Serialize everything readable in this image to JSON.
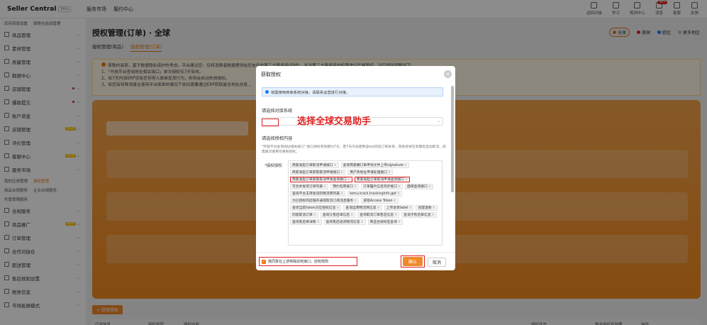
{
  "brand": {
    "name": "Seller Central",
    "badge": "Beta"
  },
  "topnav": [
    "服务市场",
    "履约中心"
  ],
  "topright": [
    {
      "label": "返回对接",
      "badge": ""
    },
    {
      "label": "学习",
      "badge": ""
    },
    {
      "label": "规则中心",
      "badge": ""
    },
    {
      "label": "消息",
      "badge": "99+"
    },
    {
      "label": "客服",
      "badge": ""
    },
    {
      "label": "反馈",
      "badge": ""
    }
  ],
  "sidebar": {
    "top_sub": [
      "库存回退设置",
      "保税仓追加管理"
    ],
    "items": [
      {
        "label": "商品管理",
        "flag": ""
      },
      {
        "label": "素材管理",
        "flag": ""
      },
      {
        "label": "质量管理",
        "flag": ""
      },
      {
        "label": "数据中心",
        "flag": ""
      },
      {
        "label": "店铺管理",
        "flag": "dot"
      },
      {
        "label": "爆款提交",
        "flag": "dot"
      },
      {
        "label": "账户资金",
        "flag": ""
      },
      {
        "label": "店铺管理",
        "flag": "NEW"
      },
      {
        "label": "评价管理",
        "flag": ""
      },
      {
        "label": "客服中心",
        "flag": "NEW"
      },
      {
        "label": "服务市场",
        "flag": ""
      }
    ],
    "sub1": [
      "我的应用管理",
      "授权管理"
    ],
    "sub2": [
      "商品合规服务",
      "企业合规服务"
    ],
    "sub3": [
      "托管保障服务"
    ],
    "items2": [
      {
        "label": "合规服务",
        "flag": ""
      },
      {
        "label": "商品推广",
        "flag": "NEW"
      },
      {
        "label": "订单管理",
        "flag": ""
      },
      {
        "label": "合作对接仓",
        "flag": ""
      },
      {
        "label": "配送管理",
        "flag": ""
      },
      {
        "label": "售后规则设置",
        "flag": ""
      },
      {
        "label": "税务信息",
        "flag": ""
      },
      {
        "label": "市场拓展模式",
        "flag": ""
      }
    ]
  },
  "page": {
    "title": "授权管理(订单) · 全球",
    "tabs": [
      "授权管理(商品)",
      "授权管理(订单)"
    ],
    "sites": [
      {
        "label": "全球",
        "color": "#e87812"
      },
      {
        "label": "美国",
        "color": "#e02020"
      },
      {
        "label": "欧区",
        "color": "#1677ff"
      },
      {
        "label": "更多地区",
        "color": "#bbbbbb"
      }
    ],
    "notice": [
      "尊敬的商家，基于数据隐私保护的考虑，平台建议您：仅将消费者数据提供给您信任的第三方服务商(ERP)，并对第三方服务商的权限进行严格管控，对应规则调整如下：",
      "1、「开放平台查询地址相关接口」单次授权仅7天有效。",
      "2、如7天内该ERP没有任何导入面单发货行为，则将会自动失效授权。",
      "3、如您有特殊场景在使用平台面单的情况下依旧需要通过ERP获取最全地址信息..."
    ],
    "get_auth": "+ 获取授权",
    "table_headers": [
      "应用信息",
      "授权类型",
      "授权内容",
      "授权状态",
      "剩余授权有效期",
      "操作"
    ]
  },
  "modal": {
    "title": "获取授权",
    "info": "如需使用商家系统对接，请联系运营进行对接。",
    "system_label": "请选择对接系统",
    "system_value": "",
    "annotation": "选择全球交易助手",
    "content_label": "请选择授权内容",
    "hint": "\"开放平台查询地址相关接口\" 接口授权有效期为7天，若7天内未使用该erp完成订单发货，则系统将在到期后自动取消，如需再次使用可重新授权。",
    "perm_label": "接权授权",
    "tags": [
      {
        "t": "商家发起订单取消申请接口",
        "hl": false
      },
      {
        "t": "查询商家端订单申诉文件上传signature",
        "hl": false
      },
      {
        "t": "商家发起订单获取取消申请接口",
        "hl": false
      },
      {
        "t": "用户改地址申请处理接口",
        "hl": false
      },
      {
        "t": "商家发起订单获取取消申请查询接口",
        "hl": true
      },
      {
        "t": "商家发起订单取消申请查询接口",
        "hl": true
      },
      {
        "t": "可合并发货订单列表",
        "hl": false
      },
      {
        "t": "预约包裹接口",
        "hl": false
      },
      {
        "t": "订单履约信息同步接口",
        "hl": false
      },
      {
        "t": "面单查询接口",
        "hl": false
      },
      {
        "t": "查询平台支持发货的物流商列表",
        "hl": false
      },
      {
        "t": "temu.track.trackinginfo.get",
        "hl": false
      },
      {
        "t": "为已授权的店铺开通或取消订阅消息服务",
        "hl": false
      },
      {
        "t": "获取Access Token",
        "hl": false
      },
      {
        "t": "查询当前token对应授权信息",
        "hl": false
      },
      {
        "t": "查询运费物流商信息",
        "hl": false
      },
      {
        "t": "上传退货label",
        "hl": false
      },
      {
        "t": "创建退款",
        "hl": false
      },
      {
        "t": "同意取消订单",
        "hl": false
      },
      {
        "t": "查询父售后单信息",
        "hl": false
      },
      {
        "t": "查询取消订单售后信息",
        "hl": false
      },
      {
        "t": "查询子售后单信息",
        "hl": false
      },
      {
        "t": "查询售后单详情",
        "hl": false
      },
      {
        "t": "查询售后退货物流信息",
        "hl": false
      },
      {
        "t": "商品合规标签查询",
        "hl": false
      }
    ],
    "agree": "我同意在上述特殊授权接口，授权规则",
    "ok": "确认",
    "cancel": "取消"
  }
}
